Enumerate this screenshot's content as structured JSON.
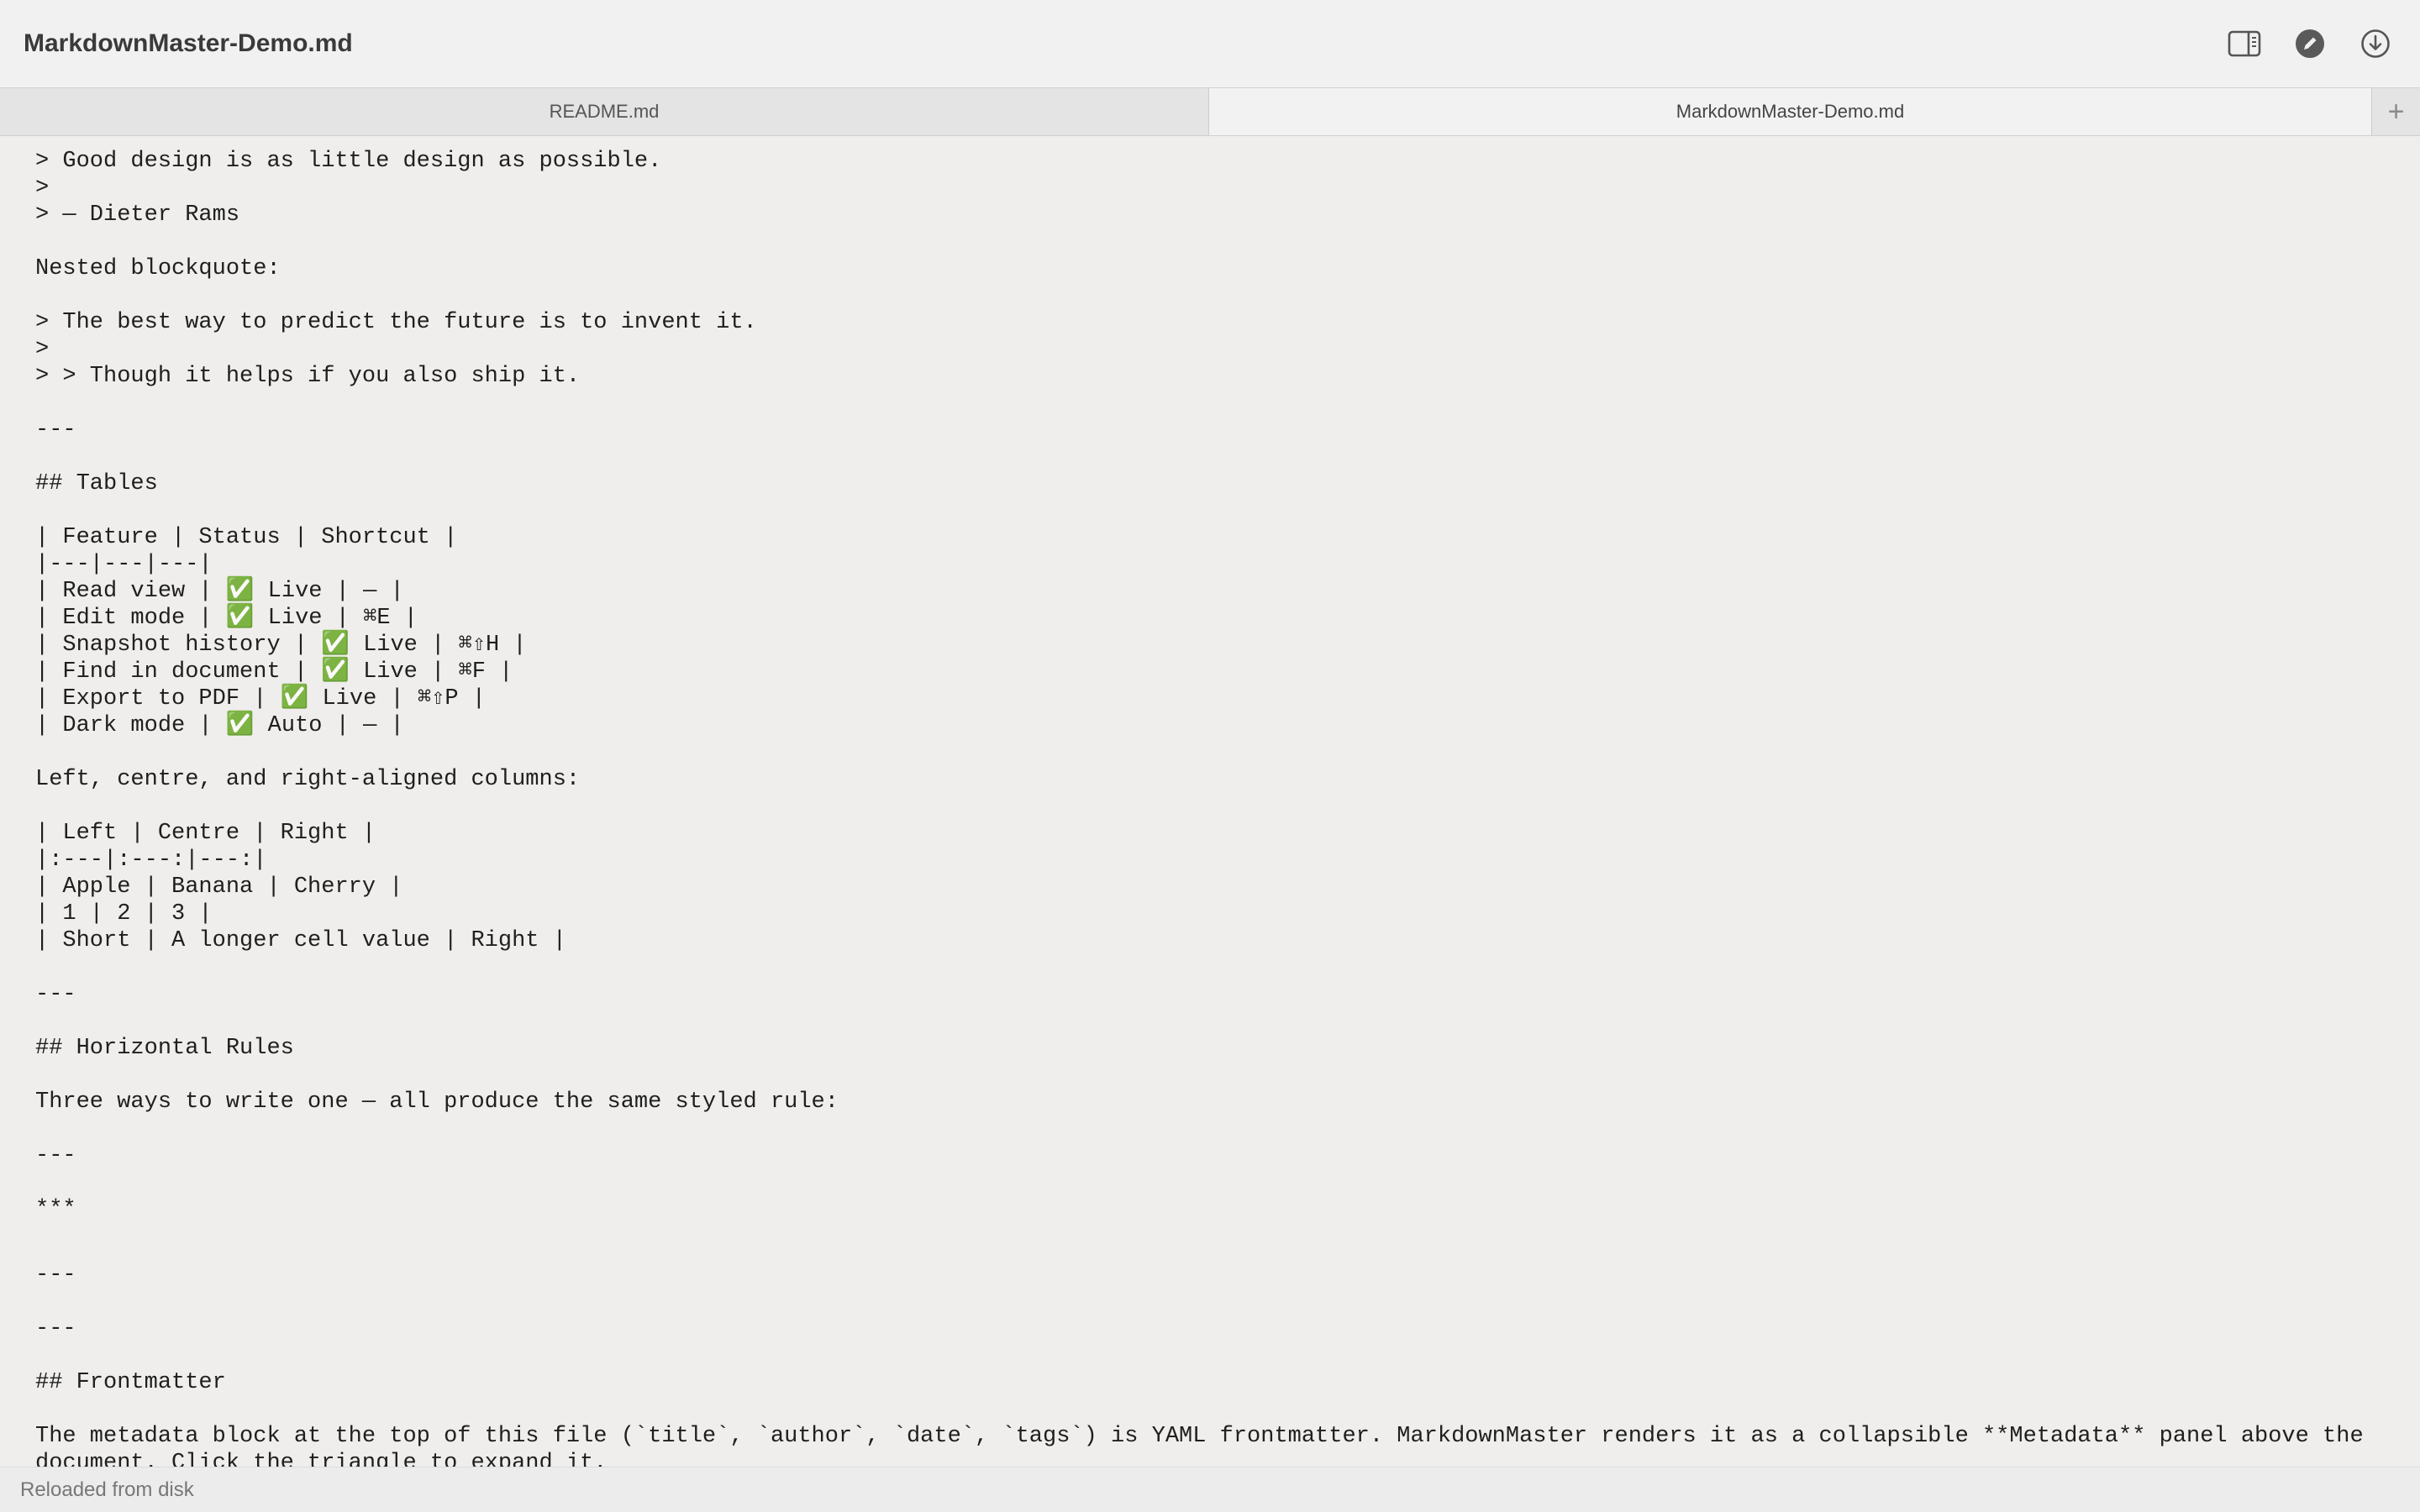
{
  "window": {
    "title": "MarkdownMaster-Demo.md"
  },
  "toolbar": {
    "icons": [
      "sidebar-toggle-icon",
      "edit-pencil-icon",
      "download-icon"
    ]
  },
  "tabs": [
    {
      "label": "README.md",
      "active": false
    },
    {
      "label": "MarkdownMaster-Demo.md",
      "active": true
    }
  ],
  "new_tab": {
    "label": "+"
  },
  "editor": {
    "lines": [
      "> Good design is as little design as possible.",
      ">",
      "> — Dieter Rams",
      "",
      "Nested blockquote:",
      "",
      "> The best way to predict the future is to invent it.",
      ">",
      "> > Though it helps if you also ship it.",
      "",
      "---",
      "",
      "## Tables",
      "",
      "| Feature | Status | Shortcut |",
      "|---|---|---|",
      "| Read view | ✅ Live | — |",
      "| Edit mode | ✅ Live | ⌘E |",
      "| Snapshot history | ✅ Live | ⌘⇧H |",
      "| Find in document | ✅ Live | ⌘F |",
      "| Export to PDF | ✅ Live | ⌘⇧P |",
      "| Dark mode | ✅ Auto | — |",
      "",
      "Left, centre, and right-aligned columns:",
      "",
      "| Left | Centre | Right |",
      "|:---|:---:|---:|",
      "| Apple | Banana | Cherry |",
      "| 1 | 2 | 3 |",
      "| Short | A longer cell value | Right |",
      "",
      "---",
      "",
      "## Horizontal Rules",
      "",
      "Three ways to write one — all produce the same styled rule:",
      "",
      "---",
      "",
      "***",
      "",
      "---",
      "",
      "---",
      "",
      "## Frontmatter",
      "",
      "The metadata block at the top of this file (`title`, `author`, `date`, `tags`) is YAML frontmatter. MarkdownMaster renders it as a collapsible **Metadata** panel above the",
      "document. Click the triangle to expand it."
    ]
  },
  "status": {
    "text": "Reloaded from disk"
  }
}
